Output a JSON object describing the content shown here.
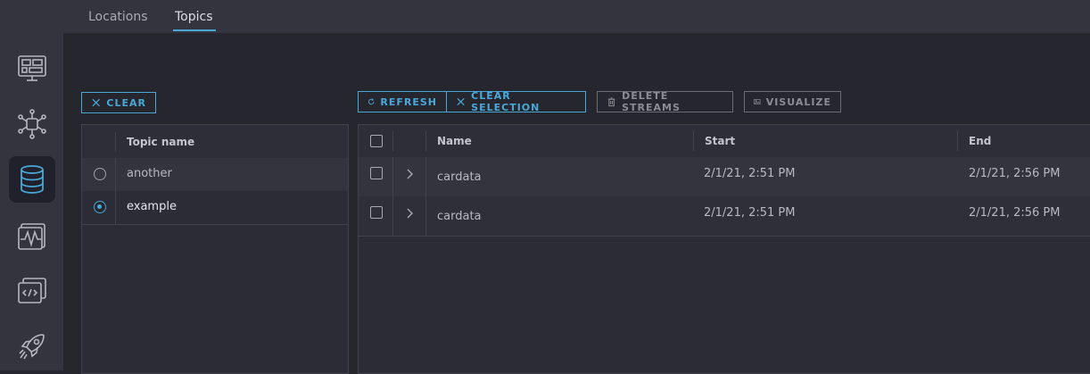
{
  "tabs": [
    {
      "label": "Locations",
      "active": false
    },
    {
      "label": "Topics",
      "active": true
    }
  ],
  "sidebar": {
    "items": [
      {
        "icon": "dashboard-icon"
      },
      {
        "icon": "hub-icon"
      },
      {
        "icon": "database-icon",
        "active": true
      },
      {
        "icon": "waveform-icon"
      },
      {
        "icon": "code-icon"
      },
      {
        "icon": "rocket-icon"
      }
    ]
  },
  "topics": {
    "clear_label": "CLEAR",
    "column_header": "Topic name",
    "rows": [
      {
        "name": "another",
        "selected": false
      },
      {
        "name": "example",
        "selected": true
      }
    ]
  },
  "streams": {
    "toolbar": {
      "refresh_label": "REFRESH",
      "clear_selection_label": "CLEAR SELECTION",
      "delete_label": "DELETE STREAMS",
      "visualize_label": "VISUALIZE"
    },
    "columns": {
      "name": "Name",
      "start": "Start",
      "end": "End"
    },
    "rows": [
      {
        "name": "cardata",
        "start": "2/1/21, 2:51 PM",
        "end": "2/1/21, 2:56 PM"
      },
      {
        "name": "cardata",
        "start": "2/1/21, 2:51 PM",
        "end": "2/1/21, 2:56 PM"
      }
    ]
  },
  "colors": {
    "accent": "#4aa8d8",
    "background": "#26262e",
    "sidebar": "#33343e"
  }
}
